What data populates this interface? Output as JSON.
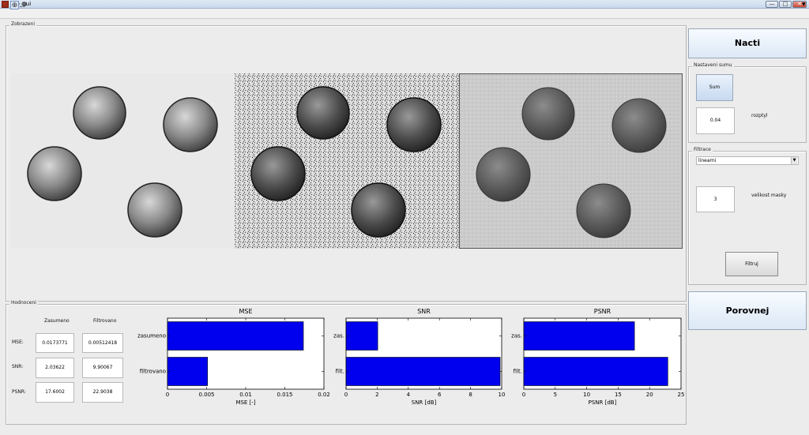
{
  "window": {
    "title": "dip_gui",
    "min": "—",
    "max": "□",
    "close": "✕"
  },
  "panels": {
    "zobrazeni": "Zobrazeni",
    "hodnoceni": "Hodnoceni",
    "nastaveni_sumu": "Nastaveni sumu",
    "filtrace": "Filtrace"
  },
  "buttons": {
    "nacti": "Nacti",
    "sum": "Sum",
    "filtruj": "Filtruj",
    "porovnej": "Porovnej"
  },
  "noise": {
    "value": "0.04",
    "label": "rozptyl"
  },
  "filter": {
    "selected": "linearni",
    "mask_value": "3",
    "mask_label": "velikost masky"
  },
  "metrics": {
    "col_noisy": "Zasumeno",
    "col_filtered": "Filtrovano",
    "rows": [
      {
        "label": "MSE:",
        "noisy": "0.0173771",
        "filtered": "0.00512418"
      },
      {
        "label": "SNR:",
        "noisy": "2.03622",
        "filtered": "9.90067"
      },
      {
        "label": "PSNR:",
        "noisy": "17.6002",
        "filtered": "22.9038"
      }
    ]
  },
  "colors": {
    "bar": "#0000ee"
  },
  "chart_data": [
    {
      "type": "bar",
      "orientation": "horizontal",
      "title": "MSE",
      "xlabel": "MSE [-]",
      "categories": [
        "zasumeno",
        "filtrovano"
      ],
      "values": [
        0.0173771,
        0.00512418
      ],
      "xlim": [
        0,
        0.02
      ],
      "ticks": [
        "0",
        "0.005",
        "0.01",
        "0.015",
        "0.02"
      ]
    },
    {
      "type": "bar",
      "orientation": "horizontal",
      "title": "SNR",
      "xlabel": "SNR [dB]",
      "categories": [
        "zas.",
        "filt."
      ],
      "values": [
        2.03622,
        9.90067
      ],
      "xlim": [
        0,
        10
      ],
      "ticks": [
        "0",
        "2",
        "4",
        "6",
        "8",
        "10"
      ]
    },
    {
      "type": "bar",
      "orientation": "horizontal",
      "title": "PSNR",
      "xlabel": "PSNR [dB]",
      "categories": [
        "zas.",
        "filt."
      ],
      "values": [
        17.6002,
        22.9038
      ],
      "xlim": [
        0,
        25
      ],
      "ticks": [
        "0",
        "5",
        "10",
        "15",
        "20",
        "25"
      ]
    }
  ]
}
